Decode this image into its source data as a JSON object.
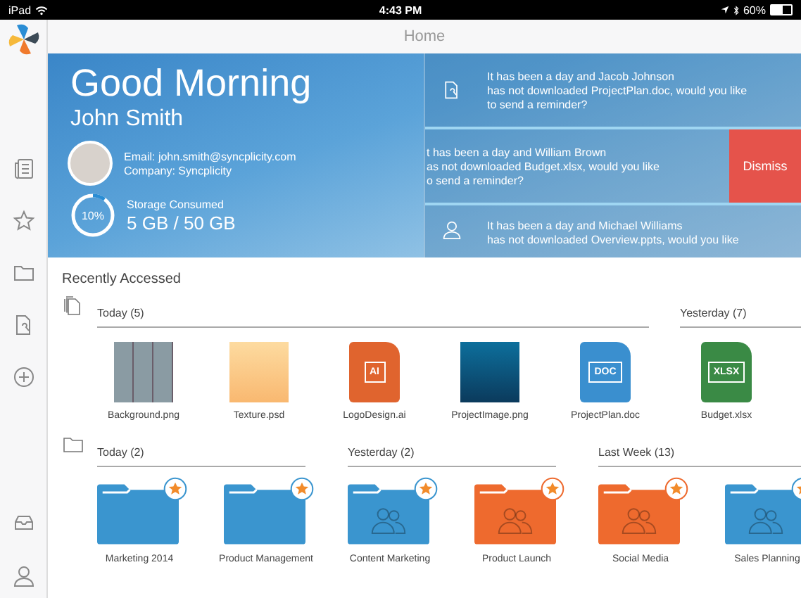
{
  "status_bar": {
    "device": "iPad",
    "time": "4:43 PM",
    "battery": "60%",
    "level": 0.6
  },
  "header": {
    "title": "Home"
  },
  "hero": {
    "greeting": "Good Morning",
    "name": "John Smith",
    "email": "Email: john.smith@syncplicity.com",
    "company": "Company: Syncplicity",
    "storage_label": "Storage Consumed",
    "storage_value": "5 GB / 50 GB",
    "storage_percent": "10%",
    "level": 0.1
  },
  "notifications": [
    {
      "kind": "document",
      "lines": [
        "It has been a day and Jacob Johnson",
        "has not downloaded ProjectPlan.doc, would you like",
        "to send a reminder?"
      ]
    },
    {
      "kind": "swiped",
      "lines": [
        "t has been a day and William Brown",
        "as not downloaded Budget.xlsx, would you like",
        "o send a reminder?"
      ],
      "action": "Dismiss"
    },
    {
      "kind": "user",
      "lines": [
        "It has been a day and Michael Williams",
        "has not downloaded Overview.ppts, would you like"
      ]
    }
  ],
  "recent": {
    "title": "Recently Accessed",
    "file_groups": [
      {
        "label": "Today (5)",
        "files": [
          {
            "name": "Background.png",
            "kind": "stripes"
          },
          {
            "name": "Texture.psd",
            "kind": "texture"
          },
          {
            "name": "LogoDesign.ai",
            "kind": "document",
            "badge": "AI",
            "color": "#e0642e"
          },
          {
            "name": "ProjectImage.png",
            "kind": "photo"
          },
          {
            "name": "ProjectPlan.doc",
            "kind": "document",
            "badge": "DOC",
            "color": "#3a8fcf"
          }
        ]
      },
      {
        "label": "Yesterday (7)",
        "files": [
          {
            "name": "Budget.xlsx",
            "kind": "document",
            "badge": "XLSX",
            "color": "#3a8a45"
          }
        ]
      }
    ],
    "folder_groups": [
      {
        "label": "Today (2)",
        "folders": [
          {
            "name": "Marketing 2014",
            "color": "#3a95cf",
            "shared": false,
            "starred": true
          },
          {
            "name": "Product Management",
            "color": "#3a95cf",
            "shared": false,
            "starred": true
          }
        ]
      },
      {
        "label": "Yesterday (2)",
        "folders": [
          {
            "name": "Content Marketing",
            "color": "#3a95cf",
            "shared": true,
            "starred": true
          },
          {
            "name": "Product Launch",
            "color": "#ee6a2e",
            "shared": true,
            "starred": true
          }
        ]
      },
      {
        "label": "Last Week (13)",
        "folders": [
          {
            "name": "Social Media",
            "color": "#ee6a2e",
            "shared": true,
            "starred": true
          },
          {
            "name": "Sales Planning",
            "color": "#3a95cf",
            "shared": true,
            "starred": true
          }
        ]
      }
    ]
  }
}
